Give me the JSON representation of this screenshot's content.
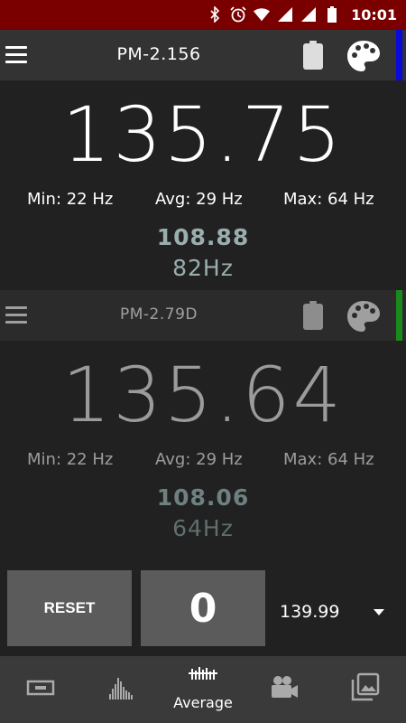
{
  "status_bar": {
    "time": "10:01",
    "icons": [
      "bluetooth-icon",
      "alarm-icon",
      "wifi-icon",
      "cell-signal-icon",
      "cell-signal-icon",
      "battery-icon"
    ],
    "background": "#7a0000"
  },
  "meters": [
    {
      "name": "PM-2.156",
      "value": "135.75",
      "min_label": "Min: 22 Hz",
      "avg_label": "Avg: 29 Hz",
      "max_label": "Max: 64 Hz",
      "sub_value": "108.88",
      "sub_freq": "82Hz",
      "sub_color": "#9aaeae",
      "strip_color": "#0a0adc"
    },
    {
      "name": "PM-2.79D",
      "value": "135.64",
      "min_label": "Min: 22 Hz",
      "avg_label": "Avg: 29 Hz",
      "max_label": "Max: 64 Hz",
      "sub_value": "108.06",
      "sub_freq": "64Hz",
      "sub_color": "#6e8080",
      "strip_color": "#1a8a1a"
    }
  ],
  "controls": {
    "reset_label": "RESET",
    "count": "0",
    "dropdown_value": "139.99"
  },
  "bottom_nav": {
    "items": [
      {
        "icon": "single-meter-icon",
        "label": ""
      },
      {
        "icon": "histogram-icon",
        "label": ""
      },
      {
        "icon": "average-icon",
        "label": "Average"
      },
      {
        "icon": "video-camera-icon",
        "label": ""
      },
      {
        "icon": "gallery-icon",
        "label": ""
      }
    ],
    "selected": "Average"
  }
}
